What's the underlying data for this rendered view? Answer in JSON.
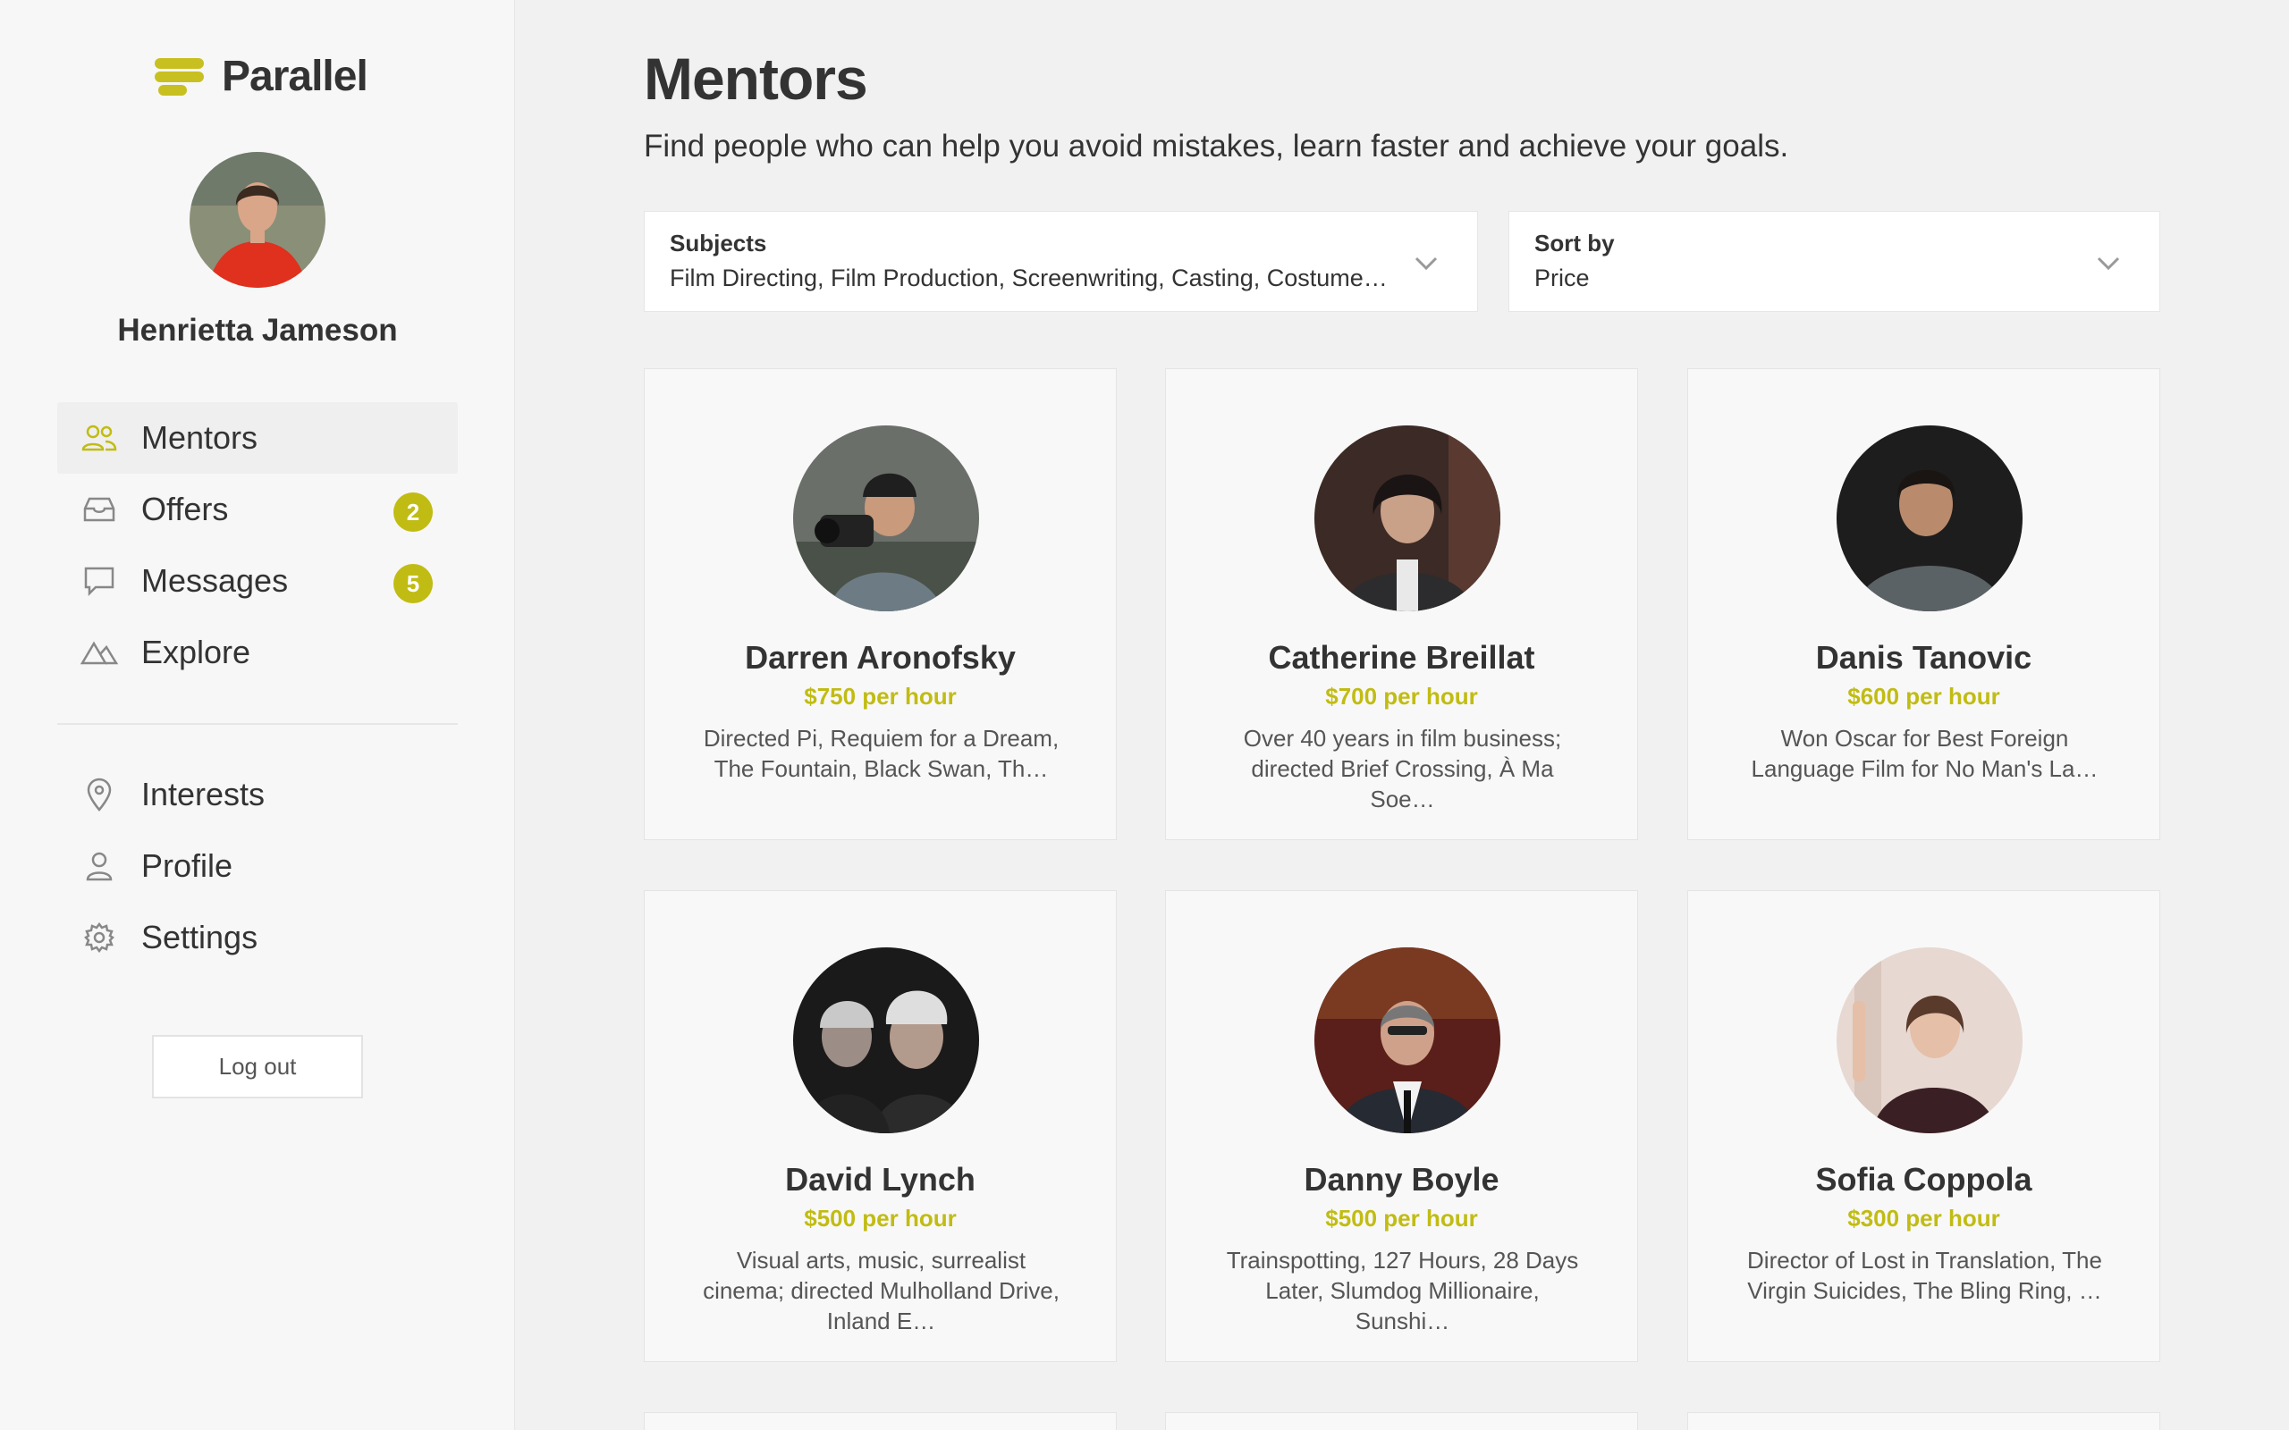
{
  "app": {
    "logo_text": "Parallel",
    "brand_color": "#c1bc13"
  },
  "user": {
    "name": "Henrietta Jameson"
  },
  "nav": {
    "primary": [
      {
        "label": "Mentors",
        "icon": "users-icon",
        "active": true
      },
      {
        "label": "Offers",
        "icon": "inbox-icon",
        "badge": "2"
      },
      {
        "label": "Messages",
        "icon": "message-icon",
        "badge": "5"
      },
      {
        "label": "Explore",
        "icon": "mountains-icon"
      }
    ],
    "secondary": [
      {
        "label": "Interests",
        "icon": "map-pin-icon"
      },
      {
        "label": "Profile",
        "icon": "user-icon"
      },
      {
        "label": "Settings",
        "icon": "gear-icon"
      }
    ],
    "logout_label": "Log out"
  },
  "page": {
    "title": "Mentors",
    "subtitle": "Find people who can help you avoid mistakes, learn faster and achieve your goals."
  },
  "filters": {
    "subjects": {
      "label": "Subjects",
      "value": "Film Directing, Film Production, Screenwriting, Casting, Costume Design"
    },
    "sort": {
      "label": "Sort by",
      "value": "Price"
    }
  },
  "mentors": [
    {
      "name": "Darren Aronofsky",
      "rate": "$750 per hour",
      "desc": "Directed Pi, Requiem for a Dream, The Fountain, Black Swan, Th…"
    },
    {
      "name": "Catherine Breillat",
      "rate": "$700 per hour",
      "desc": "Over 40 years in film business; directed Brief Crossing, À Ma Soe…"
    },
    {
      "name": "Danis Tanovic",
      "rate": "$600 per hour",
      "desc": "Won Oscar for Best Foreign Language Film for No Man's La…"
    },
    {
      "name": "David Lynch",
      "rate": "$500 per hour",
      "desc": "Visual arts, music, surrealist cinema; directed Mulholland Drive, Inland E…"
    },
    {
      "name": "Danny Boyle",
      "rate": "$500 per hour",
      "desc": "Trainspotting, 127 Hours, 28 Days Later, Slumdog Millionaire, Sunshi…"
    },
    {
      "name": "Sofia Coppola",
      "rate": "$300 per hour",
      "desc": "Director of Lost in Translation, The Virgin Suicides, The Bling Ring, …"
    }
  ]
}
